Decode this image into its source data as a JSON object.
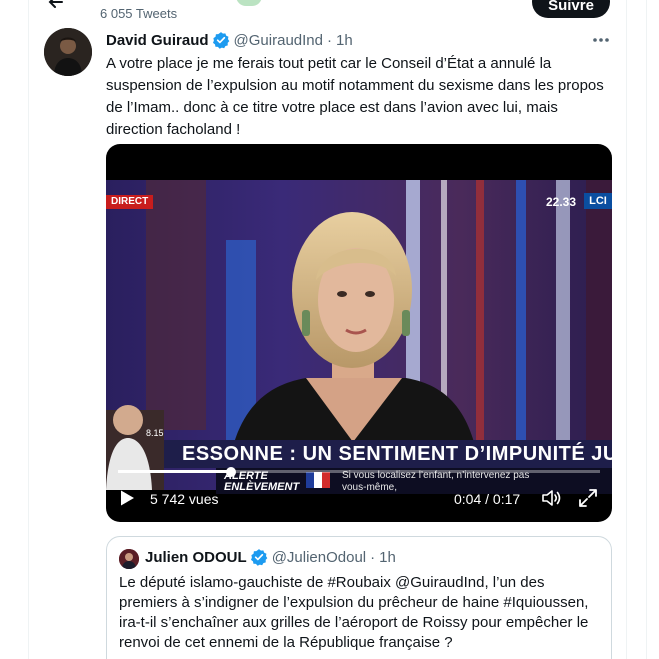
{
  "header": {
    "tweet_count": "6 055 Tweets",
    "follow_label": "Suivre"
  },
  "tweet": {
    "author_name": "David Guiraud",
    "handle": "@GuiraudInd",
    "dot": "·",
    "time": "1h",
    "text": "A votre place je me ferais tout petit car le Conseil d’État a annulé la suspension de l’expulsion au motif notamment du sexisme dans les propos de l’Imam.. donc à ce titre votre place est dans l’avion avec lui, mais direction facholand !",
    "icons": {
      "verified": "verified-badge-icon",
      "more": "more-options-icon",
      "back": "back-arrow-icon"
    }
  },
  "video": {
    "overlay": {
      "direct_tag": "DIRECT",
      "clock": "22.33",
      "channel": "LCI",
      "inset_time": "8.15",
      "headline": "ESSONNE : UN SENTIMENT D’IMPUNITÉ JUSTIFIÉ",
      "alert_line1": "ALERTE",
      "alert_line2": "ENLÈVEMENT",
      "alert_message": "Si vous localisez l’enfant, n’intervenez pas vous-même,"
    },
    "views": "5 742 vues",
    "time_readout": "0:04 / 0:17",
    "progress": 0.235,
    "icons": {
      "play": "play-icon",
      "volume": "volume-icon",
      "fullscreen": "fullscreen-icon"
    }
  },
  "quoted_tweet": {
    "author_name": "Julien ODOUL",
    "handle": "@JulienOdoul",
    "dot": "·",
    "time": "1h",
    "text": "Le député islamo-gauchiste de #Roubaix @GuiraudInd, l’un des premiers à s’indigner de l’expulsion du prêcheur de haine #Iquioussen, ira-t-il s’enchaîner aux grilles de l’aéroport de Roissy pour empêcher le renvoi de cet ennemi de la République française ?"
  },
  "colors": {
    "accent": "#1d9bf0",
    "text_primary": "#0f1419",
    "text_secondary": "#536471",
    "border": "#cfd9de",
    "headline_band": "#1e1e4a"
  }
}
